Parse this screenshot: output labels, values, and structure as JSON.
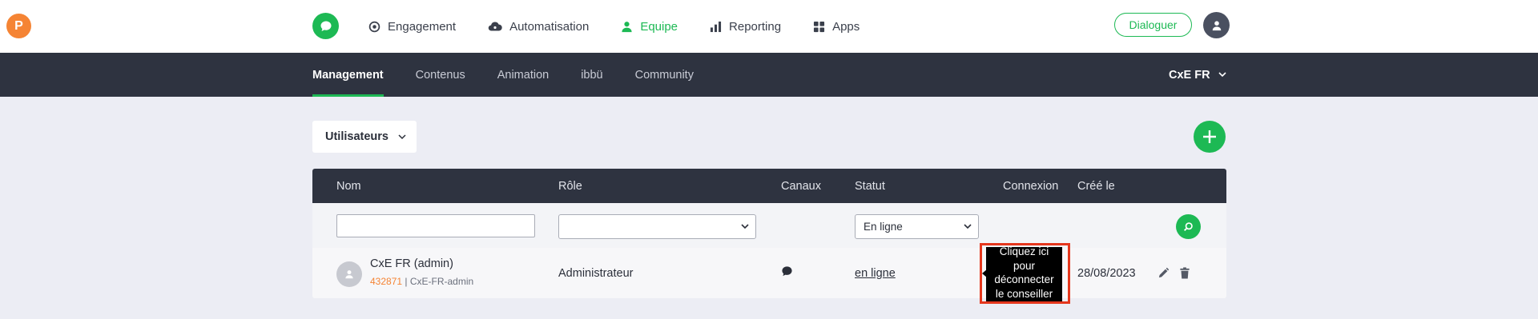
{
  "brand": {
    "initial": "P",
    "color": "#f58434"
  },
  "accent": "#1db954",
  "nav": {
    "items": [
      {
        "label": "Engagement",
        "icon": "target-icon",
        "active": false
      },
      {
        "label": "Automatisation",
        "icon": "cloud-icon",
        "active": false
      },
      {
        "label": "Equipe",
        "icon": "person-icon",
        "active": true
      },
      {
        "label": "Reporting",
        "icon": "bar-chart-icon",
        "active": false
      },
      {
        "label": "Apps",
        "icon": "grid-icon",
        "active": false
      }
    ],
    "dialoguer_label": "Dialoguer"
  },
  "subnav": {
    "items": [
      {
        "label": "Management",
        "active": true
      },
      {
        "label": "Contenus",
        "active": false
      },
      {
        "label": "Animation",
        "active": false
      },
      {
        "label": "ibbü",
        "active": false
      },
      {
        "label": "Community",
        "active": false
      }
    ],
    "org": "CxE FR"
  },
  "content": {
    "type_select": "Utilisateurs"
  },
  "table": {
    "columns": {
      "nom": "Nom",
      "role": "Rôle",
      "canaux": "Canaux",
      "statut": "Statut",
      "connexion": "Connexion",
      "cree_le": "Créé le"
    },
    "filters": {
      "nom_value": "",
      "role_value": "",
      "statut_value": "En ligne"
    },
    "rows": [
      {
        "name": "CxE FR (admin)",
        "id": "432871",
        "separator": " | ",
        "login": "CxE-FR-admin",
        "role": "Administrateur",
        "canaux_icon": "chat-bubble-icon",
        "status": "en ligne",
        "created": "28/08/2023"
      }
    ]
  },
  "tooltip": {
    "lines": [
      "Cliquez ici",
      "pour",
      "déconnecter",
      "le conseiller"
    ]
  }
}
